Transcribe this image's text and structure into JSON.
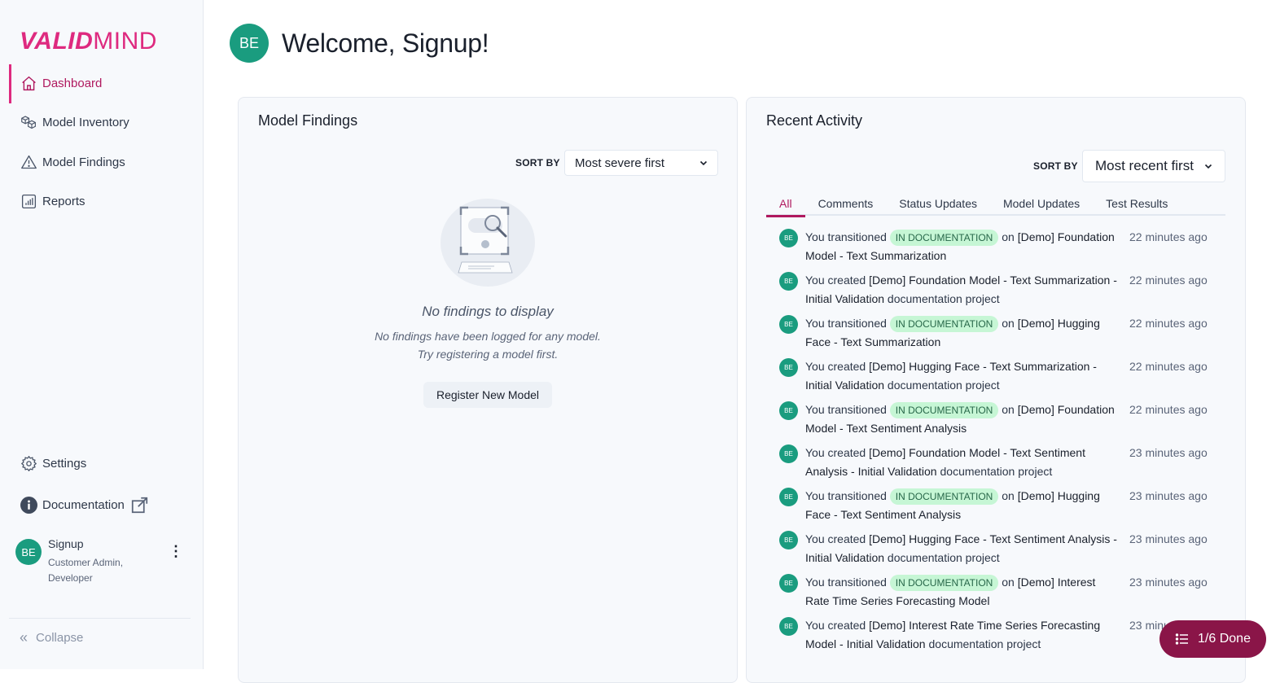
{
  "brand": {
    "logo_bold": "VALID",
    "logo_light": "MIND",
    "accent": "#de2a7f"
  },
  "sidebar": {
    "items": [
      {
        "label": "Dashboard",
        "icon": "home-icon",
        "active": true
      },
      {
        "label": "Model Inventory",
        "icon": "cubes-icon"
      },
      {
        "label": "Model Findings",
        "icon": "warning-triangle-icon"
      },
      {
        "label": "Reports",
        "icon": "bar-chart-icon"
      }
    ],
    "bottom_items": [
      {
        "label": "Settings",
        "icon": "gear-icon"
      },
      {
        "label": "Documentation",
        "icon": "info-icon",
        "external": true
      }
    ],
    "user": {
      "initials": "BE",
      "name": "Signup",
      "roles": "Customer Admin, Developer"
    },
    "collapse_label": "Collapse"
  },
  "header": {
    "initials": "BE",
    "title": "Welcome, Signup!"
  },
  "findings": {
    "title": "Model Findings",
    "sort_label": "SORT BY",
    "sort_value": "Most severe first",
    "empty_title": "No findings to display",
    "empty_line1": "No findings have been logged for any model.",
    "empty_line2": "Try registering a model first.",
    "register_button": "Register New Model"
  },
  "activity": {
    "title": "Recent Activity",
    "sort_label": "SORT BY",
    "sort_value": "Most recent first",
    "tabs": [
      "All",
      "Comments",
      "Status Updates",
      "Model Updates",
      "Test Results"
    ],
    "active_tab": "All",
    "badge_label": "IN DOCUMENTATION",
    "items": [
      {
        "initials": "BE",
        "type": "transition",
        "prefix": "You transitioned",
        "mid": "on",
        "target": "[Demo] Foundation Model - Text Summarization",
        "suffix": "",
        "time": "22 minutes ago"
      },
      {
        "initials": "BE",
        "type": "create",
        "prefix": "You created",
        "target": "[Demo] Foundation Model - Text Summarization - Initial Validation",
        "suffix": "documentation project",
        "time": "22 minutes ago"
      },
      {
        "initials": "BE",
        "type": "transition",
        "prefix": "You transitioned",
        "mid": "on",
        "target": "[Demo] Hugging Face - Text Summarization",
        "suffix": "",
        "time": "22 minutes ago"
      },
      {
        "initials": "BE",
        "type": "create",
        "prefix": "You created",
        "target": "[Demo] Hugging Face - Text Summarization - Initial Validation",
        "suffix": "documentation project",
        "time": "22 minutes ago"
      },
      {
        "initials": "BE",
        "type": "transition",
        "prefix": "You transitioned",
        "mid": "on",
        "target": "[Demo] Foundation Model - Text Sentiment Analysis",
        "suffix": "",
        "time": "22 minutes ago"
      },
      {
        "initials": "BE",
        "type": "create",
        "prefix": "You created",
        "target": "[Demo] Foundation Model - Text Sentiment Analysis - Initial Validation",
        "suffix": "documentation project",
        "time": "23 minutes ago"
      },
      {
        "initials": "BE",
        "type": "transition",
        "prefix": "You transitioned",
        "mid": "on",
        "target": "[Demo] Hugging Face - Text Sentiment Analysis",
        "suffix": "",
        "time": "23 minutes ago"
      },
      {
        "initials": "BE",
        "type": "create",
        "prefix": "You created",
        "target": "[Demo] Hugging Face - Text Sentiment Analysis - Initial Validation",
        "suffix": "documentation project",
        "time": "23 minutes ago"
      },
      {
        "initials": "BE",
        "type": "transition",
        "prefix": "You transitioned",
        "mid": "on",
        "target": "[Demo] Interest Rate Time Series Forecasting Model",
        "suffix": "",
        "time": "23 minutes ago"
      },
      {
        "initials": "BE",
        "type": "create",
        "prefix": "You created",
        "target": "[Demo] Interest Rate Time Series Forecasting Model - Initial Validation",
        "suffix": "documentation project",
        "time": "23 minutes ago"
      }
    ]
  },
  "checklist_button": {
    "label": "1/6 Done",
    "icon": "list-icon"
  }
}
